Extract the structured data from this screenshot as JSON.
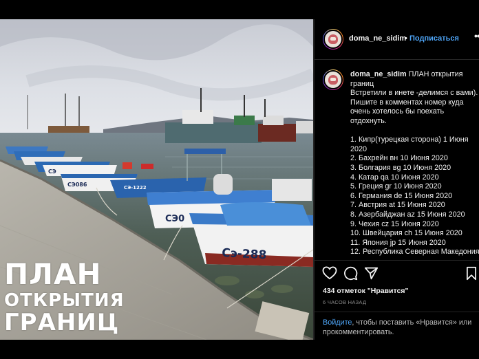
{
  "post": {
    "username": "doma_ne_sidim",
    "dot": "•",
    "follow_label": "Подписаться",
    "more_label": "...",
    "caption": {
      "username": "doma_ne_sidim",
      "lines": [
        "ПЛАН открытия",
        "границ",
        "Встретили в инете -делимся с вами).",
        "Пишите в комментах номер куда",
        "очень хотелось бы поехать",
        "отдохнуть.",
        "",
        "1. Кипр(турецкая сторона) 1 Июня",
        "2020",
        "2. Бахрейн вн 10 Июня 2020",
        "3. Болгария вg 10 Июня 2020",
        "4. Катар qa 10 Июня 2020",
        "5. Греция gr 10 Июня 2020",
        "6. Германия de 15 Июня 2020",
        "7. Австрия at 15 Июня 2020",
        "8. Азербайджан az 15 Июня 2020",
        "9. Чехия cz 15 Июня 2020",
        "10. Швейцария ch 15 Июня 2020",
        "11. Япония jp 15 Июня 2020",
        "12. Республика Северная Македония"
      ]
    },
    "likes": "434 отметок \"Нравится\"",
    "time_ago": "6 ЧАСОВ НАЗАД",
    "login_link": "Войдите",
    "login_rest": ", чтобы поставить «Нравится» или прокомментировать."
  },
  "image": {
    "overlay_line1": "ПЛАН",
    "overlay_line2": "ОТКРЫТИЯ",
    "overlay_line3": "ГРАНИЦ",
    "boat_numbers": [
      "Сэ-288",
      "СЭ0",
      "СЭ-1222",
      "СЭ086",
      "СЭ"
    ]
  },
  "icons": {
    "like": "heart-icon",
    "comment": "comment-icon",
    "share": "share-icon",
    "save": "bookmark-icon",
    "more": "more-icon"
  },
  "colors": {
    "link": "#4ea5f7",
    "background": "#000000",
    "separator": "#262626"
  }
}
